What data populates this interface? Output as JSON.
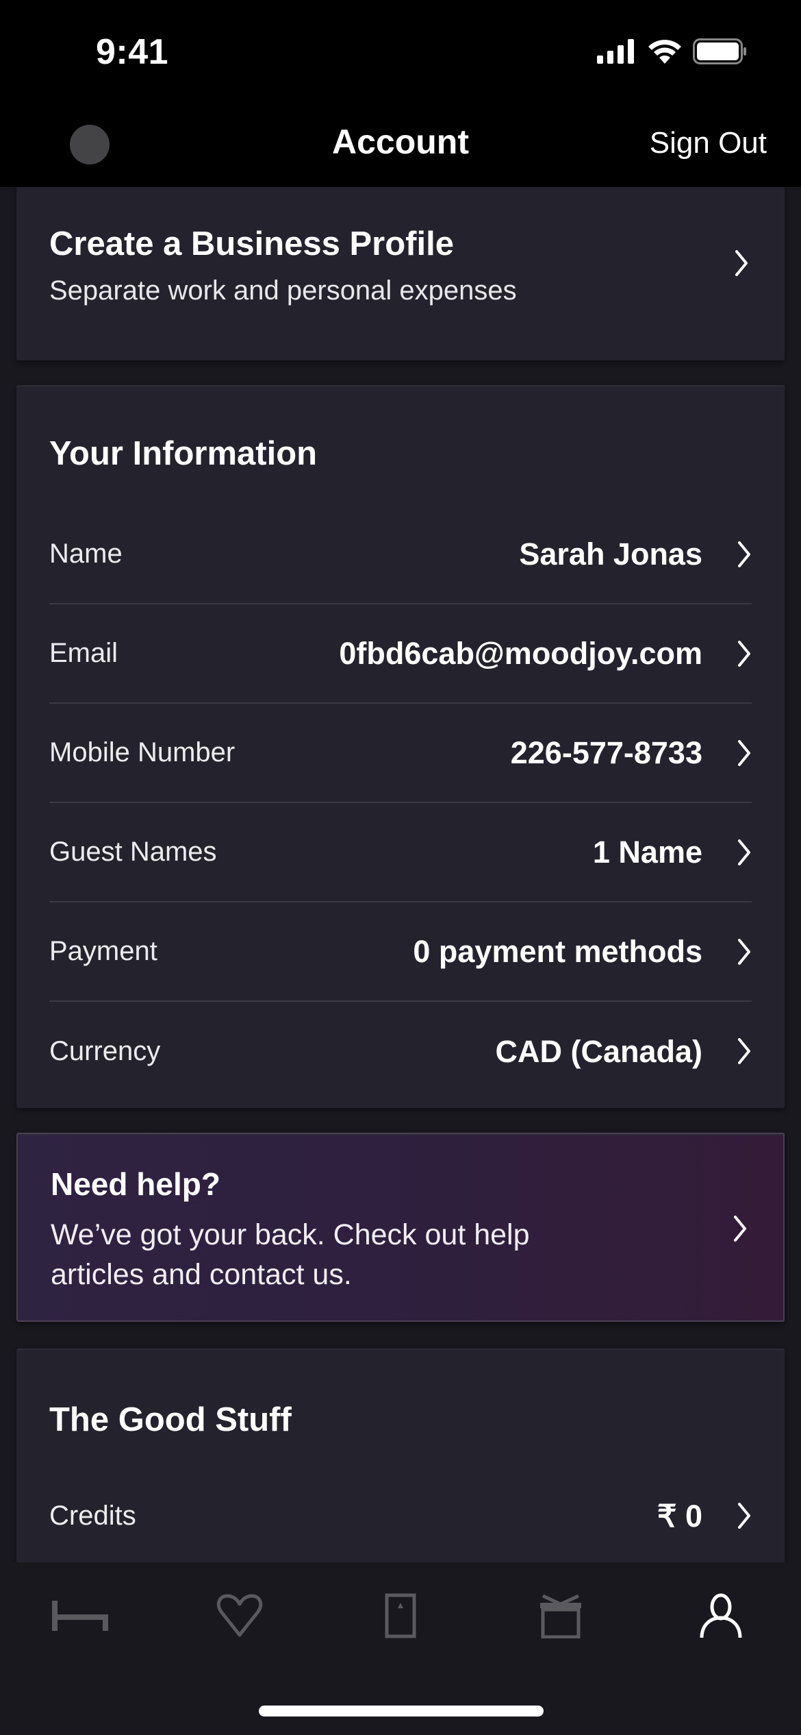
{
  "status_bar": {
    "time": "9:41",
    "icons": [
      "signal-icon",
      "wifi-icon",
      "battery-icon"
    ]
  },
  "nav": {
    "title": "Account",
    "sign_out_label": "Sign Out",
    "avatar": "avatar"
  },
  "business_profile": {
    "title": "Create a Business Profile",
    "subtitle": "Separate work and personal expenses",
    "icon": "chevron-right-icon"
  },
  "your_information": {
    "title": "Your Information",
    "rows": [
      {
        "label": "Name",
        "value": "Sarah Jonas"
      },
      {
        "label": "Email",
        "value": "0fbd6cab@moodjoy.com"
      },
      {
        "label": "Mobile Number",
        "value": "226-577-8733"
      },
      {
        "label": "Guest Names",
        "value": "1 Name"
      },
      {
        "label": "Payment",
        "value": "0 payment methods"
      },
      {
        "label": "Currency",
        "value": "CAD (Canada)"
      }
    ]
  },
  "help": {
    "title": "Need help?",
    "subtitle": "We’ve got your back. Check out help articles and contact us."
  },
  "good_stuff": {
    "title": "The Good Stuff",
    "rows": [
      {
        "label": "Credits",
        "value": "₹ 0"
      }
    ]
  },
  "tab_bar": {
    "items": [
      {
        "name": "bed-icon",
        "active": false
      },
      {
        "name": "heart-icon",
        "active": false
      },
      {
        "name": "phone-icon",
        "active": false
      },
      {
        "name": "gift-icon",
        "active": false
      },
      {
        "name": "person-icon",
        "active": true
      }
    ]
  },
  "colors": {
    "background": "#19181e",
    "card": "#24232d",
    "header": "#000000",
    "inactive_icon": "#5a595e",
    "active_icon": "#ffffff"
  }
}
